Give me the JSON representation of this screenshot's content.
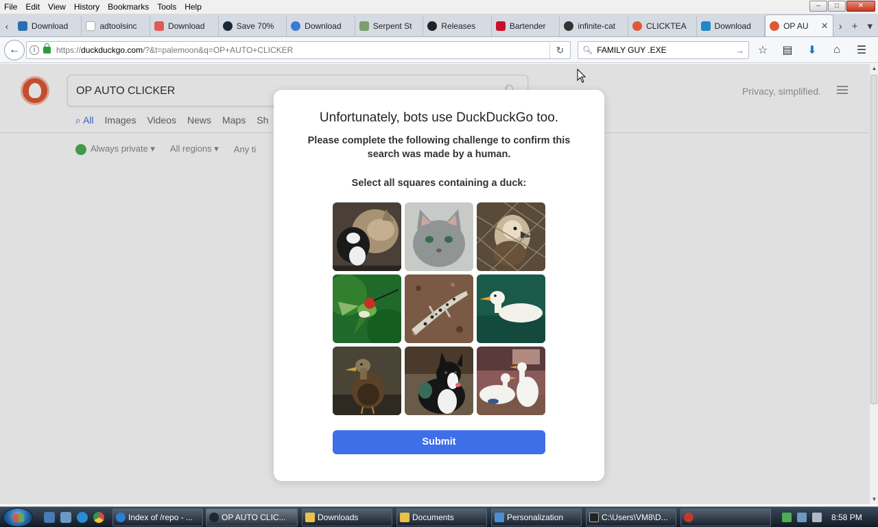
{
  "menu": [
    "File",
    "Edit",
    "View",
    "History",
    "Bookmarks",
    "Tools",
    "Help"
  ],
  "tabs": [
    {
      "label": "Download",
      "color": "#2d6db3"
    },
    {
      "label": "adtoolsinc",
      "color": "#ffffff"
    },
    {
      "label": "Download",
      "color": "#e05a5a"
    },
    {
      "label": "Save 70%",
      "color": "#1b2838"
    },
    {
      "label": "Download",
      "color": "#3a7bd5"
    },
    {
      "label": "Serpent St",
      "color": "#7aa070"
    },
    {
      "label": "Releases",
      "color": "#222222"
    },
    {
      "label": "Bartender",
      "color": "#c8102e"
    },
    {
      "label": "infinite-cat",
      "color": "#333333"
    },
    {
      "label": "CLICKTEA",
      "color": "#de5833"
    },
    {
      "label": "Download",
      "color": "#1e88c8"
    }
  ],
  "active_tab": {
    "label": "OP AU",
    "color": "#de5833"
  },
  "url": {
    "prefix": "https://",
    "host": "duckduckgo.com",
    "path": "/?&t=palemoon&q=OP+AUTO+CLICKER"
  },
  "search": {
    "value": "FAMILY GUY .EXE"
  },
  "ddg": {
    "query": "OP AUTO CLICKER",
    "privacy": "Privacy, simplified.",
    "tabs": [
      "All",
      "Images",
      "Videos",
      "News",
      "Maps",
      "Sh"
    ],
    "filters": [
      "Always private ▾",
      "All regions ▾",
      "Any ti"
    ]
  },
  "modal": {
    "title": "Unfortunately, bots use DuckDuckGo too.",
    "subtitle": "Please complete the following challenge to confirm this search was made by a human.",
    "prompt": "Select all squares containing a duck:",
    "submit": "Submit",
    "tiles": [
      "cats",
      "gray-cat",
      "bird-in-cage",
      "hummingbird",
      "leopard-lizard",
      "white-duck-swimming",
      "mallard-duck",
      "border-collie",
      "white-geese"
    ]
  },
  "taskbar": {
    "items": [
      {
        "label": "Index of /repo - ...",
        "color": "#2a7fd4"
      },
      {
        "label": "OP AUTO CLIC...",
        "color": "#1b2838"
      },
      {
        "label": "Downloads",
        "color": "#e8c34a"
      },
      {
        "label": "Documents",
        "color": "#e8c34a"
      },
      {
        "label": "Personalization",
        "color": "#4a8fd4"
      },
      {
        "label": "C:\\Users\\VM8\\D...",
        "color": "#222222"
      },
      {
        "label": "",
        "color": "#c0392b"
      }
    ],
    "clock": "8:58 PM"
  }
}
